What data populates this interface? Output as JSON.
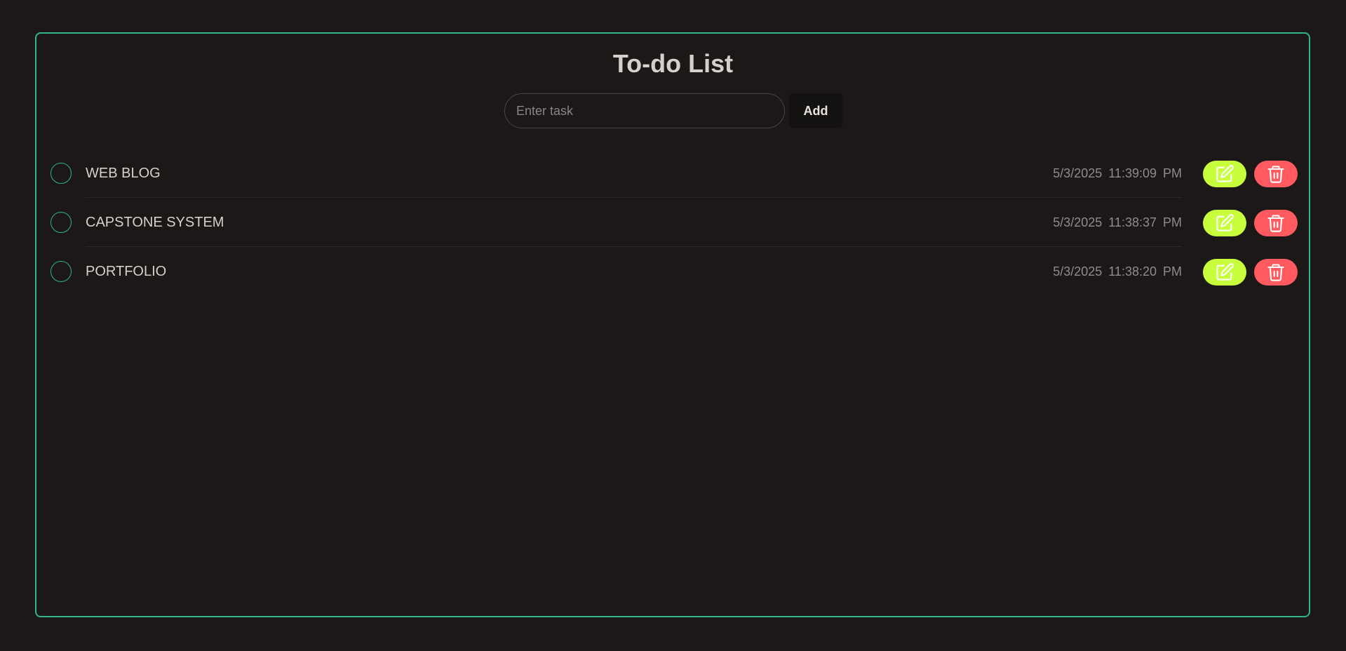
{
  "app": {
    "title": "To-do List"
  },
  "input": {
    "placeholder": "Enter task",
    "value": ""
  },
  "add_button": {
    "label": "Add"
  },
  "tasks": [
    {
      "text": "WEB BLOG",
      "timestamp": "5/3/2025 11:39:09 PM",
      "completed": false
    },
    {
      "text": "CAPSTONE SYSTEM",
      "timestamp": "5/3/2025 11:38:37 PM",
      "completed": false
    },
    {
      "text": "PORTFOLIO",
      "timestamp": "5/3/2025 11:38:20 PM",
      "completed": false
    }
  ],
  "icons": {
    "edit": "edit-icon",
    "delete": "trash-icon",
    "check": "circle-check-icon"
  },
  "colors": {
    "background": "#1c1818",
    "border_accent": "#2fb58a",
    "edit_button": "#c8ff3c",
    "delete_button": "#ff5a5f",
    "text": "#d4d0cc",
    "timestamp": "#8e8a92"
  }
}
